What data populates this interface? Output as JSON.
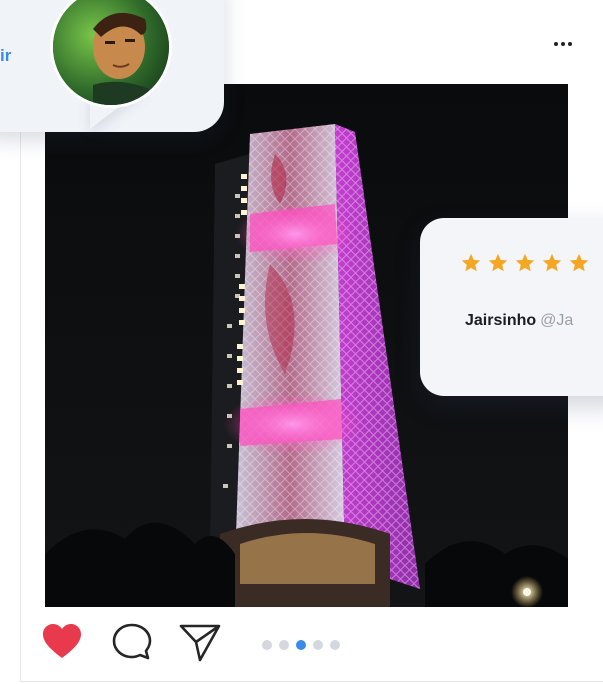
{
  "post": {
    "more_menu_icon": "more-horizontal-icon",
    "photo_description": "night-lit-tower-photo"
  },
  "actions": {
    "like_icon": "heart-icon",
    "comment_icon": "comment-icon",
    "share_icon": "send-icon",
    "like_color": "#e8394d",
    "carousel": {
      "count": 5,
      "active_index": 2,
      "active_color": "#3a8be8",
      "inactive_color": "#d4d8de"
    }
  },
  "speech_bubble": {
    "partial_text": "ir"
  },
  "review": {
    "rating": 5,
    "star_color": "#f5a623",
    "author_name": "Jairsinho",
    "author_handle": "@Ja"
  }
}
